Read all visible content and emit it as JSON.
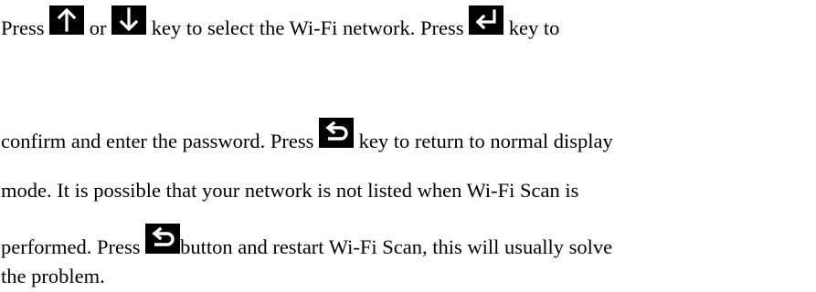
{
  "paragraph": {
    "line1": {
      "before_up": "Press",
      "or": "or",
      "after_down": "key to select the Wi-Fi network. Press",
      "after_enter": "key to"
    },
    "line2": {
      "before_return": "confirm and enter the password. Press",
      "after_return": "key to return to normal display"
    },
    "line3": "mode. It is possible that your network is not listed when Wi-Fi Scan is",
    "line4": {
      "before_return": "performed. Press",
      "after_return": "button and restart Wi-Fi Scan, this will usually solve"
    },
    "line5": "the problem."
  },
  "icons": {
    "up": "arrow-up-key-icon",
    "down": "arrow-down-key-icon",
    "enter": "enter-key-icon",
    "return": "return-key-icon"
  },
  "colors": {
    "key_background": "#000000",
    "key_symbol": "#ffffff",
    "text": "#000000"
  }
}
